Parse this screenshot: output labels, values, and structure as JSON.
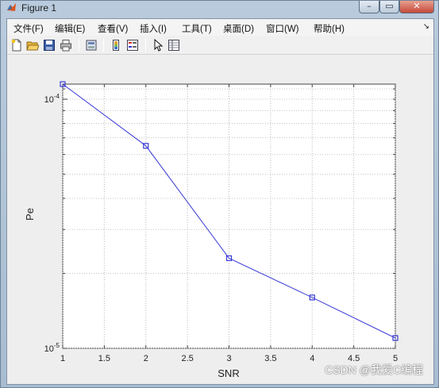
{
  "window": {
    "title": "Figure 1",
    "controls": {
      "minimize": "–",
      "maximize": "▭",
      "close": "✕"
    }
  },
  "menu": {
    "items": [
      "文件(F)",
      "编辑(E)",
      "查看(V)",
      "插入(I)",
      "工具(T)",
      "桌面(D)",
      "窗口(W)",
      "帮助(H)"
    ],
    "overflow_arrow": "↘"
  },
  "toolbar": {
    "icons": [
      "new-figure-icon",
      "open-file-icon",
      "save-icon",
      "print-icon",
      "print-preview-icon",
      "insert-colorbar-icon",
      "insert-legend-icon",
      "edit-plot-cursor-icon",
      "property-inspector-icon"
    ]
  },
  "chart_data": {
    "type": "line",
    "x": [
      1,
      2,
      3,
      4,
      5
    ],
    "y": [
      0.000115,
      6.5e-05,
      2.3e-05,
      1.6e-05,
      1.1e-05
    ],
    "xlabel": "SNR",
    "ylabel": "Pe",
    "xlim": [
      1,
      5
    ],
    "ylim": [
      1e-05,
      0.000115
    ],
    "yscale": "log",
    "xticks": [
      "1",
      "1.5",
      "2",
      "2.5",
      "3",
      "3.5",
      "4",
      "4.5",
      "5"
    ],
    "yticks": [
      {
        "value": 0.0001,
        "base": "10",
        "exp": "-4"
      },
      {
        "value": 1e-05,
        "base": "10",
        "exp": "-5"
      }
    ],
    "grid": true,
    "line_color": "#3a3ad6",
    "marker": "square"
  },
  "watermark": "CSDN @我爱C编程"
}
